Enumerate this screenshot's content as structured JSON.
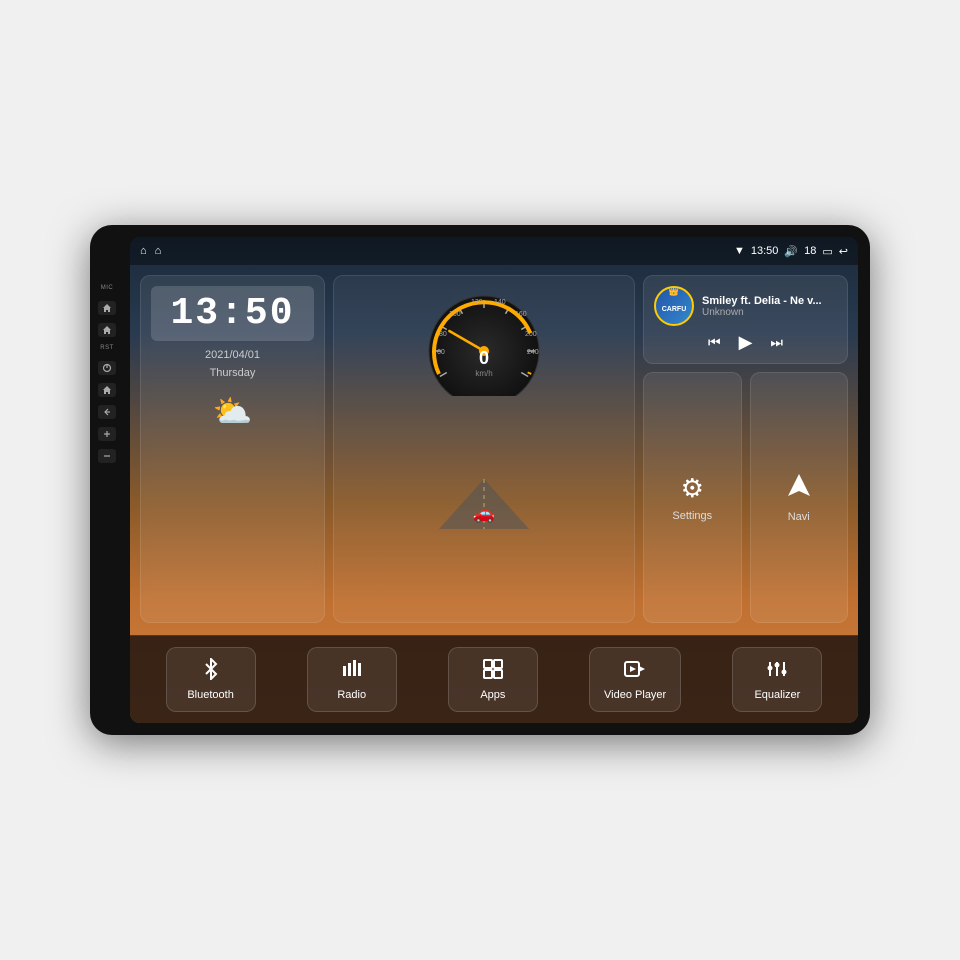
{
  "device": {
    "status_bar": {
      "home_label": "⌂",
      "home2_label": "⌂",
      "time": "13:50",
      "volume_icon": "🔊",
      "volume_level": "18",
      "battery_icon": "🔋",
      "back_icon": "↩"
    },
    "clock": {
      "time": "13:50",
      "date": "2021/04/01",
      "day": "Thursday"
    },
    "music": {
      "title": "Smiley ft. Delia - Ne v...",
      "artist": "Unknown",
      "logo_text": "CARFU"
    },
    "settings_btn": "Settings",
    "navi_btn": "Navi",
    "bottom_buttons": [
      {
        "id": "bluetooth",
        "label": "Bluetooth",
        "icon": "bluetooth"
      },
      {
        "id": "radio",
        "label": "Radio",
        "icon": "radio"
      },
      {
        "id": "apps",
        "label": "Apps",
        "icon": "apps"
      },
      {
        "id": "video",
        "label": "Video Player",
        "icon": "video"
      },
      {
        "id": "equalizer",
        "label": "Equalizer",
        "icon": "equalizer"
      }
    ],
    "side_buttons": [
      {
        "label": "MIC",
        "icon": "mic"
      },
      {
        "label": "RST",
        "icon": "rst"
      },
      {
        "icon": "power"
      },
      {
        "icon": "home"
      },
      {
        "icon": "back"
      },
      {
        "icon": "vol_up"
      },
      {
        "icon": "vol_down"
      }
    ]
  }
}
